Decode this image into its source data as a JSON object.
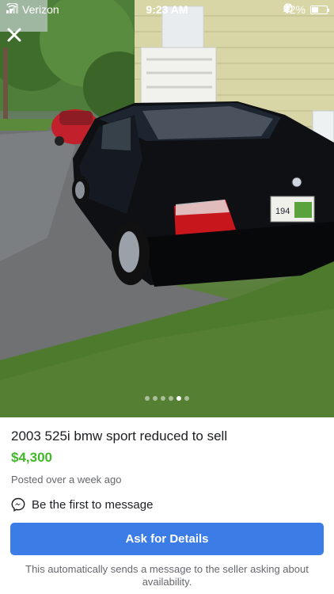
{
  "status_bar": {
    "carrier": "Verizon",
    "time": "9:23 AM",
    "battery": "42%",
    "battery_level": 0.42
  },
  "icons": {
    "close": "close-icon",
    "wifi": "wifi-icon",
    "location": "location-arrow-icon",
    "bluetooth": "bluetooth-icon",
    "lock_rotation": "orientation-lock-icon",
    "messenger": "messenger-icon"
  },
  "photo": {
    "page_count": 6,
    "active_index": 4
  },
  "listing": {
    "title": "2003 525i bmw sport reduced to sell",
    "price": "$4,300",
    "posted": "Posted over a week ago",
    "message_prompt": "Be the first to message",
    "ask_button": "Ask for Details",
    "note": "This automatically sends a message to the seller asking about availability."
  },
  "colors": {
    "price": "#42b72a",
    "button": "#3b7ce6"
  }
}
